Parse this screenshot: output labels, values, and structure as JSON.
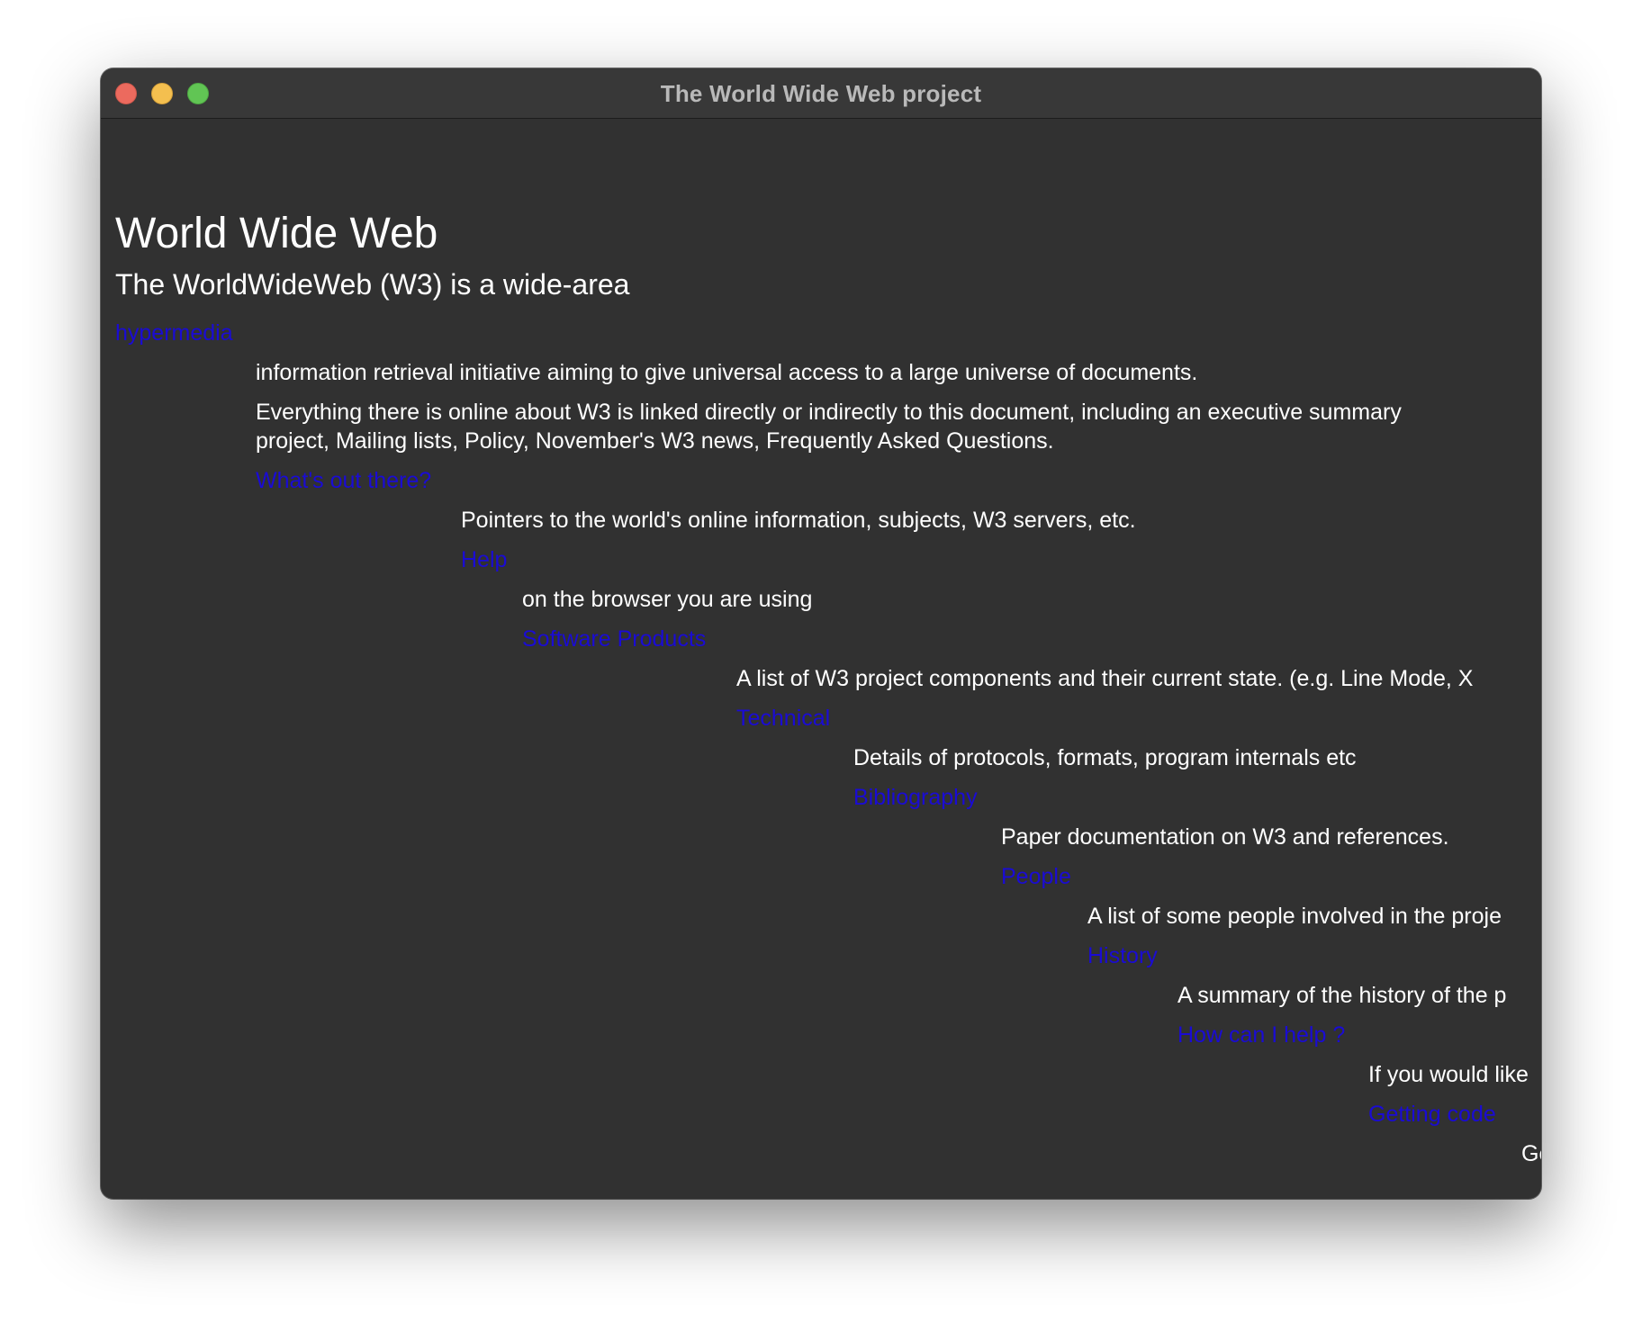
{
  "window": {
    "title": "The World Wide Web project"
  },
  "page": {
    "heading": "World Wide Web",
    "intro": "The WorldWideWeb (W3) is a wide-area",
    "hypermedia_link": "hypermedia",
    "intro_continued": "information retrieval initiative aiming to give universal access to a large universe of documents.",
    "everything_line1": "Everything there is online about W3 is linked directly or indirectly to this document, including an executive summary",
    "everything_line2": "project, Mailing lists, Policy, November's W3 news, Frequently Asked Questions.",
    "entries": [
      {
        "link": "What's out there?",
        "description": "Pointers to the world's online information, subjects, W3 servers, etc."
      },
      {
        "link": "Help",
        "description": "on the browser you are using"
      },
      {
        "link": "Software Products",
        "description": "A list of W3 project components and their current state. (e.g. Line Mode, X"
      },
      {
        "link": "Technical",
        "description": "Details of protocols, formats, program internals etc"
      },
      {
        "link": "Bibliography",
        "description": "Paper documentation on  W3 and references."
      },
      {
        "link": "People",
        "description": "A list of some people involved in the proje"
      },
      {
        "link": "History",
        "description": "A summary of the history of the p"
      },
      {
        "link": "How can I help ?",
        "description": "If you would like"
      },
      {
        "link": "Getting code",
        "description": "Ge"
      }
    ]
  },
  "colors": {
    "background": "#313131",
    "text": "#ffffff",
    "link": "#1a0bd4",
    "titlebar": "#383838",
    "title_text": "#b9b9b9"
  }
}
